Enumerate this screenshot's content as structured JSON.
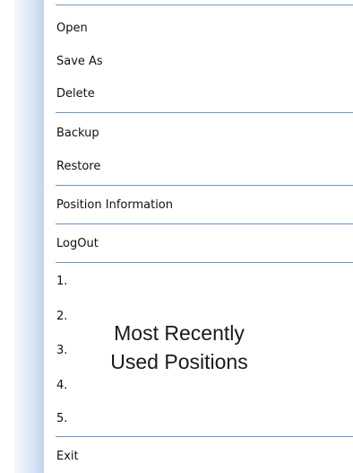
{
  "menu": {
    "items": [
      {
        "label": "Open"
      },
      {
        "label": "Save As"
      },
      {
        "label": "Delete"
      },
      {
        "label": "Backup"
      },
      {
        "label": "Restore"
      },
      {
        "label": "Position Information"
      },
      {
        "label": "LogOut"
      },
      {
        "label": "1."
      },
      {
        "label": "2."
      },
      {
        "label": "3."
      },
      {
        "label": "4."
      },
      {
        "label": "5."
      },
      {
        "label": "Exit"
      }
    ]
  },
  "annotation": {
    "line1": "Most Recently",
    "line2": "Used Positions"
  },
  "colors": {
    "separator": "#6f91cc",
    "gutter": "#c4d4ef"
  }
}
